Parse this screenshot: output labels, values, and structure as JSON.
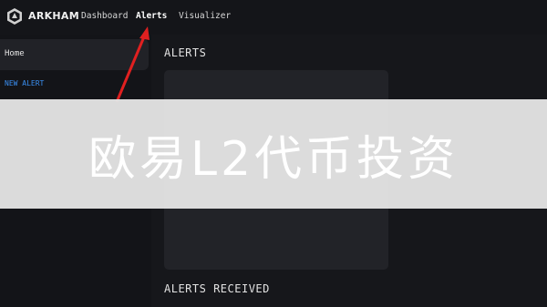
{
  "header": {
    "brand": "ARKHAM",
    "logo_icon": "arkham-logo-icon",
    "nav": [
      {
        "label": "Dashboard",
        "active": false
      },
      {
        "label": "Alerts",
        "active": true
      },
      {
        "label": "Visualizer",
        "active": false
      }
    ]
  },
  "sidebar": {
    "home_label": "Home",
    "new_alert_label": "NEW ALERT"
  },
  "main": {
    "alerts_title": "ALERTS",
    "received_title": "ALERTS RECEIVED"
  },
  "overlay": {
    "text": "欧易L2代币投资"
  },
  "colors": {
    "background": "#16171b",
    "panel": "#222328",
    "accent_link": "#3a8ef0",
    "arrow": "#e02020",
    "banner": "#e2e2e2"
  }
}
